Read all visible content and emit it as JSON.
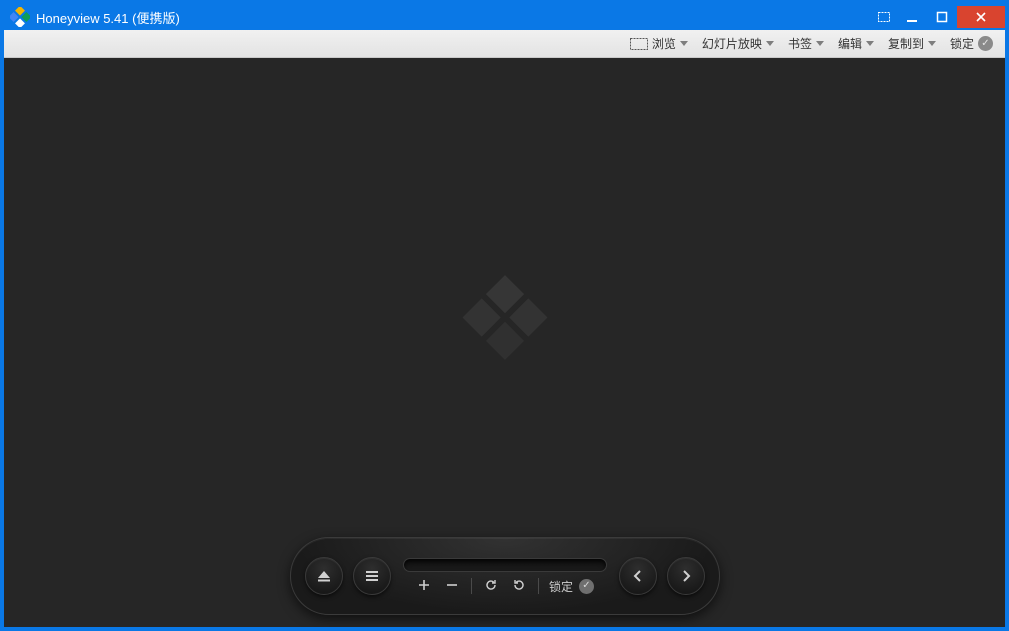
{
  "window": {
    "title": "Honeyview 5.41 (便携版)"
  },
  "toolbar": {
    "browse": "浏览",
    "slideshow": "幻灯片放映",
    "bookmark": "书签",
    "edit": "编辑",
    "copyto": "复制到",
    "lock": "锁定"
  },
  "panel": {
    "lock": "锁定"
  }
}
